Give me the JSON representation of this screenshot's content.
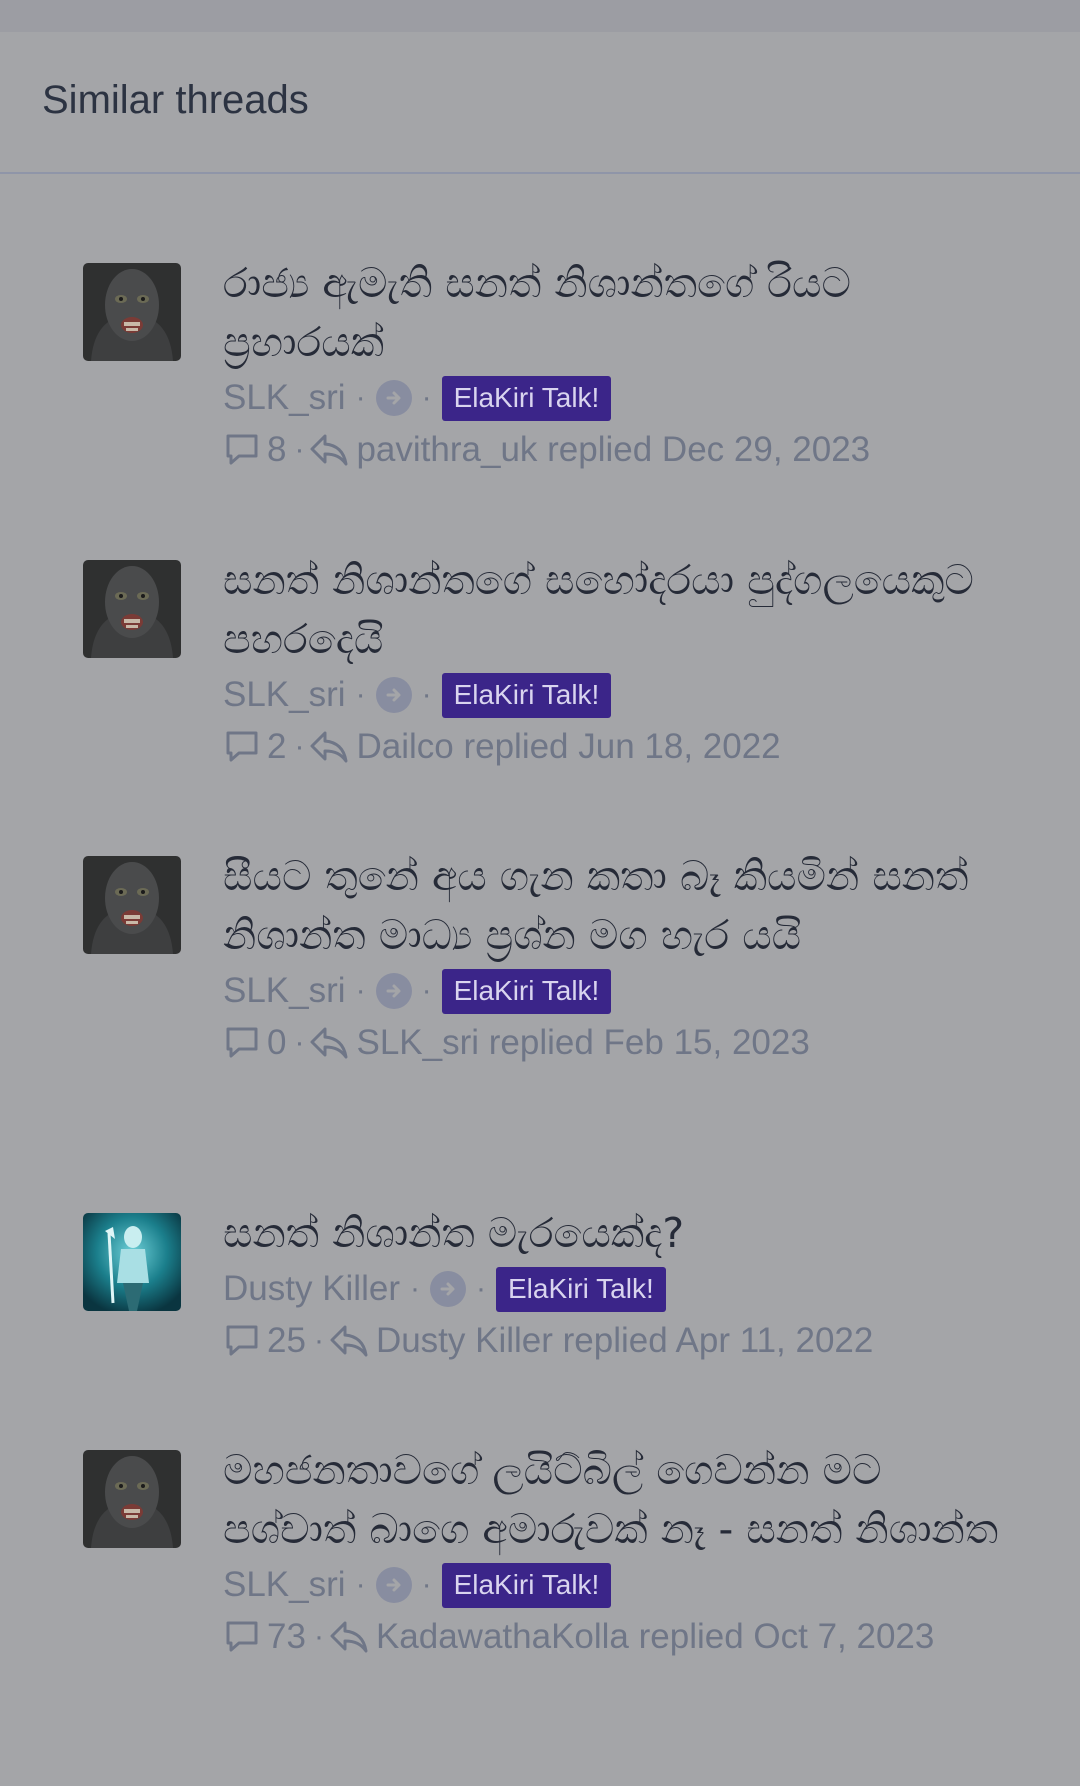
{
  "block": {
    "title": "Similar threads"
  },
  "threads": [
    {
      "title": "රාජ්‍ය ඇමැති සනත් නිශාන්තගේ රියට ප්‍රහාරයක්",
      "author": "SLK_sri",
      "forum": "ElaKiri Talk!",
      "reply_count": "8",
      "last_reply": "pavithra_uk replied Dec 29, 2023",
      "avatar": "masked-figure"
    },
    {
      "title": "සනත් නිශාන්තගේ සහෝදරයා පුද්ගලයෙකුට පහරදෙයි",
      "author": "SLK_sri",
      "forum": "ElaKiri Talk!",
      "reply_count": "2",
      "last_reply": "Dailco replied Jun 18, 2022",
      "avatar": "masked-figure"
    },
    {
      "title": "සීයට තුනේ අය ගැන කතා බෑ කියමින් සනත් නිශාන්ත මාධ්‍ය ප්‍රශ්න මග හැර යයි",
      "author": "SLK_sri",
      "forum": "ElaKiri Talk!",
      "reply_count": "0",
      "last_reply": "SLK_sri replied Feb 15, 2023",
      "avatar": "masked-figure"
    },
    {
      "title": "සනත් නිශාන්ත මැරයෙක්ද?",
      "author": "Dusty Killer",
      "forum": "ElaKiri Talk!",
      "reply_count": "25",
      "last_reply": "Dusty Killer replied Apr 11, 2022",
      "avatar": "blue-warrior"
    },
    {
      "title": "මහජනතාවගේ ලයිට්බිල් ගෙවන්න මට පශ්චාත් බාගෙ අමාරුවක් නෑ - සනත් නිශාන්ත",
      "author": "SLK_sri",
      "forum": "ElaKiri Talk!",
      "reply_count": "73",
      "last_reply": "KadawathaKolla replied Oct 7, 2023",
      "avatar": "masked-figure"
    }
  ],
  "colors": {
    "background": "#a4a5a8",
    "badge": "#3b2589",
    "title_text": "#262b38",
    "meta_text": "#6f7687"
  },
  "icons": {
    "replies": "comment-bubble-icon",
    "last_reply": "reply-arrow-icon",
    "author_separator": "arrow-right-circle-icon"
  }
}
